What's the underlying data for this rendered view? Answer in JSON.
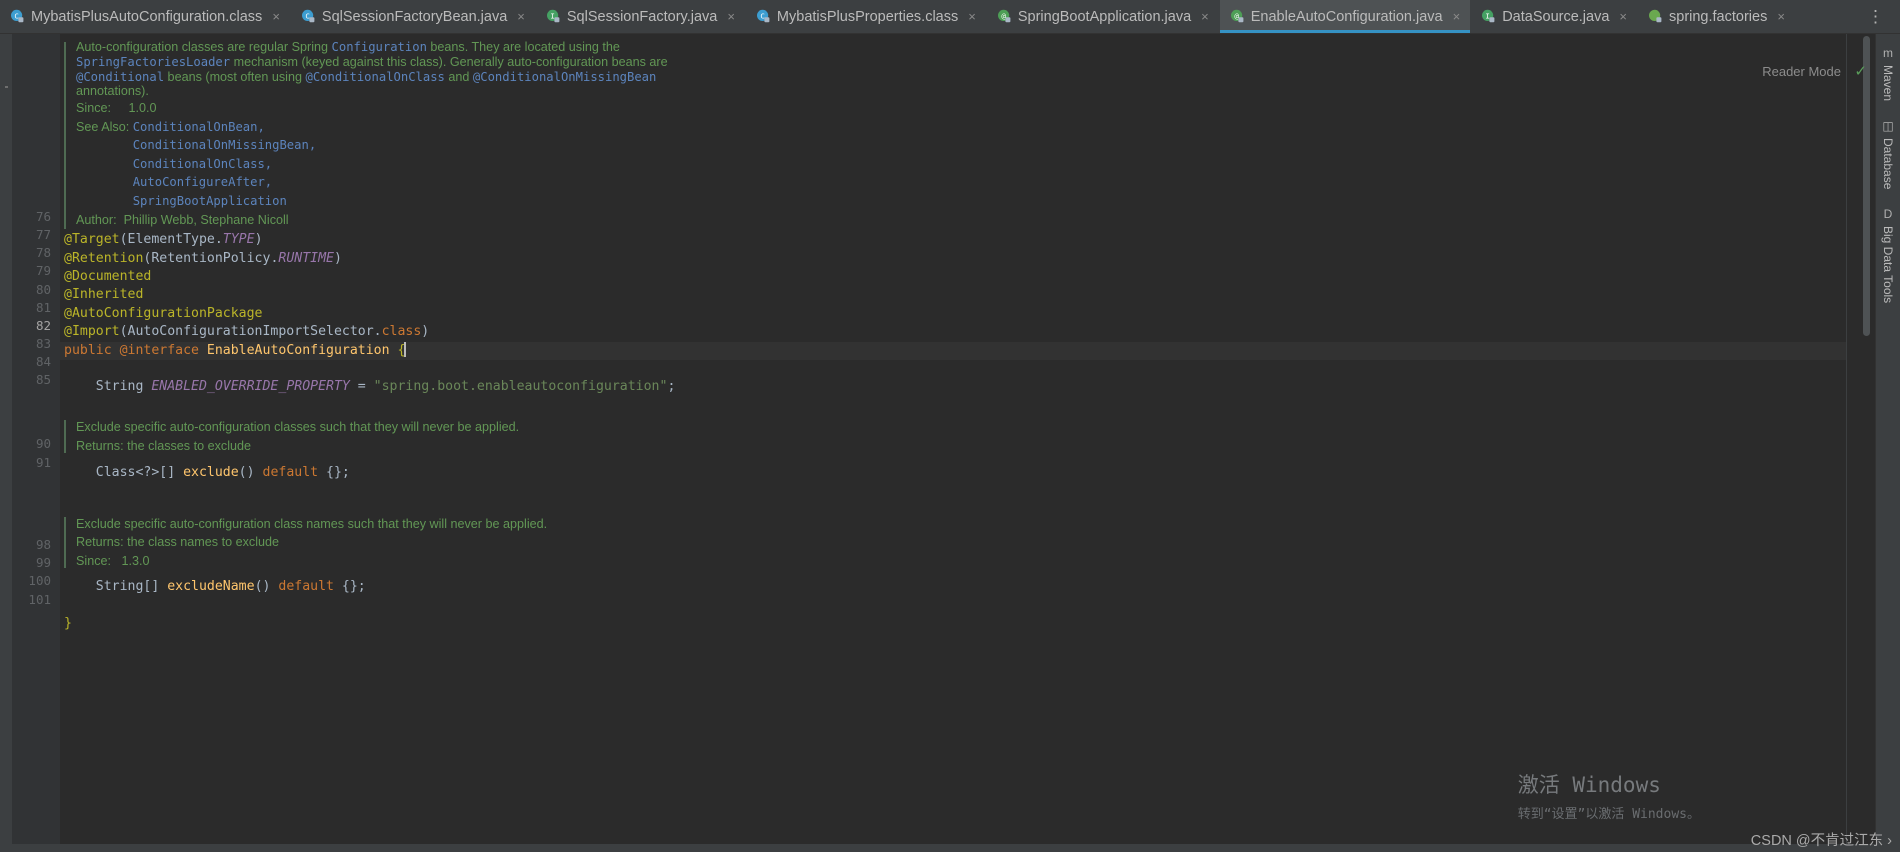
{
  "window": {
    "title": "EnableAutoConfiguration.java",
    "more_options_icon": "kebab-menu-icon"
  },
  "tabs": [
    {
      "label": "MybatisPlusAutoConfiguration.class",
      "icon": "java-class-file-icon",
      "icon_kind": "class",
      "active": false,
      "close": "×"
    },
    {
      "label": "SqlSessionFactoryBean.java",
      "icon": "java-class-file-icon",
      "icon_kind": "class",
      "active": false,
      "close": "×"
    },
    {
      "label": "SqlSessionFactory.java",
      "icon": "java-interface-file-icon",
      "icon_kind": "interface",
      "active": false,
      "close": "×"
    },
    {
      "label": "MybatisPlusProperties.class",
      "icon": "java-class-file-icon",
      "icon_kind": "class",
      "active": false,
      "close": "×"
    },
    {
      "label": "SpringBootApplication.java",
      "icon": "java-annotation-file-icon",
      "icon_kind": "annotation",
      "active": false,
      "close": "×"
    },
    {
      "label": "EnableAutoConfiguration.java",
      "icon": "java-annotation-file-icon",
      "icon_kind": "annotation",
      "active": true,
      "close": "×"
    },
    {
      "label": "DataSource.java",
      "icon": "java-interface-file-icon",
      "icon_kind": "interface",
      "active": false,
      "close": "×"
    },
    {
      "label": "spring.factories",
      "icon": "spring-factories-file-icon",
      "icon_kind": "spring",
      "active": false,
      "close": "×"
    }
  ],
  "editor": {
    "reader_mode_label": "Reader Mode",
    "inspection_status_icon": "green-check-icon",
    "javadoc_class": {
      "paragraph": [
        {
          "segments": [
            {
              "t": "Auto-configuration classes are regular Spring ",
              "k": "text"
            },
            {
              "t": "Configuration",
              "k": "code"
            },
            {
              "t": " beans. They are located using the",
              "k": "text"
            }
          ]
        },
        {
          "segments": [
            {
              "t": "SpringFactoriesLoader",
              "k": "code"
            },
            {
              "t": " mechanism (keyed against this class). Generally auto-configuration beans are",
              "k": "text"
            }
          ]
        },
        {
          "segments": [
            {
              "t": "@Conditional",
              "k": "code"
            },
            {
              "t": " beans (most often using ",
              "k": "text"
            },
            {
              "t": "@ConditionalOnClass",
              "k": "code"
            },
            {
              "t": " and ",
              "k": "text"
            },
            {
              "t": "@ConditionalOnMissingBean",
              "k": "code"
            }
          ]
        },
        {
          "segments": [
            {
              "t": "annotations).",
              "k": "text"
            }
          ]
        }
      ],
      "since_label": "Since:",
      "since_value": "1.0.0",
      "see_also_label": "See Also:",
      "see_also": [
        "ConditionalOnBean,",
        "ConditionalOnMissingBean,",
        "ConditionalOnClass,",
        "AutoConfigureAfter,",
        "SpringBootApplication"
      ],
      "author_label": "Author:",
      "author_value": "Phillip Webb, Stephane Nicoll"
    },
    "line_numbers": [
      "76",
      "77",
      "78",
      "79",
      "80",
      "81",
      "82",
      "83",
      "84",
      "85",
      "90",
      "91",
      "98",
      "99",
      "100",
      "101"
    ],
    "code_lines": [
      {
        "num": "76",
        "fold": true,
        "tokens": [
          {
            "t": "@Target",
            "k": "anno"
          },
          {
            "t": "(ElementType.",
            "k": "plain"
          },
          {
            "t": "TYPE",
            "k": "field"
          },
          {
            "t": ")",
            "k": "plain"
          }
        ]
      },
      {
        "num": "77",
        "tokens": [
          {
            "t": "@Retention",
            "k": "anno"
          },
          {
            "t": "(RetentionPolicy.",
            "k": "plain"
          },
          {
            "t": "RUNTIME",
            "k": "field"
          },
          {
            "t": ")",
            "k": "plain"
          }
        ]
      },
      {
        "num": "78",
        "tokens": [
          {
            "t": "@Documented",
            "k": "anno"
          }
        ]
      },
      {
        "num": "79",
        "tokens": [
          {
            "t": "@Inherited",
            "k": "anno"
          }
        ]
      },
      {
        "num": "80",
        "tokens": [
          {
            "t": "@AutoConfigurationPackage",
            "k": "anno"
          }
        ]
      },
      {
        "num": "81",
        "bulb": true,
        "tokens": [
          {
            "t": "@Import",
            "k": "anno"
          },
          {
            "t": "(AutoConfigurationImportSelector.",
            "k": "plain"
          },
          {
            "t": "class",
            "k": "kw"
          },
          {
            "t": ")",
            "k": "plain"
          }
        ]
      },
      {
        "num": "82",
        "current": true,
        "tokens": [
          {
            "t": "public ",
            "k": "kw"
          },
          {
            "t": "@interface ",
            "k": "kw"
          },
          {
            "t": "EnableAutoConfiguration ",
            "k": "typename"
          },
          {
            "t": "{",
            "k": "anno"
          }
        ]
      },
      {
        "num": "83",
        "tokens": []
      },
      {
        "num": "84",
        "tokens": [
          {
            "t": "    String ",
            "k": "plain"
          },
          {
            "t": "ENABLED_OVERRIDE_PROPERTY",
            "k": "field"
          },
          {
            "t": " = ",
            "k": "plain"
          },
          {
            "t": "\"spring.boot.enableautoconfiguration\"",
            "k": "str"
          },
          {
            "t": ";",
            "k": "plain"
          }
        ]
      },
      {
        "num": "85",
        "tokens": []
      }
    ],
    "javadoc_exclude": {
      "description": "Exclude specific auto-configuration classes such that they will never be applied.",
      "returns": "Returns: the classes to exclude"
    },
    "exclude_method": {
      "num": "90",
      "tokens": [
        {
          "t": "    Class<?>[] ",
          "k": "plain"
        },
        {
          "t": "exclude",
          "k": "typename"
        },
        {
          "t": "() ",
          "k": "plain"
        },
        {
          "t": "default ",
          "k": "kw"
        },
        {
          "t": "{};",
          "k": "plain"
        }
      ]
    },
    "javadoc_exclude_name": {
      "description": "Exclude specific auto-configuration class names such that they will never be applied.",
      "returns": "Returns: the class names to exclude",
      "since_label": "Since:",
      "since_value": "1.3.0"
    },
    "exclude_name_method": {
      "num": "98",
      "tokens": [
        {
          "t": "    String[] ",
          "k": "plain"
        },
        {
          "t": "excludeName",
          "k": "typename"
        },
        {
          "t": "() ",
          "k": "plain"
        },
        {
          "t": "default ",
          "k": "kw"
        },
        {
          "t": "{};",
          "k": "plain"
        }
      ]
    },
    "closing_brace": {
      "num": "100",
      "tokens": [
        {
          "t": "}",
          "k": "anno"
        }
      ]
    },
    "last_line": "101"
  },
  "right_toolbar": [
    {
      "label": "Maven",
      "icon": "maven-icon",
      "glyph": "m"
    },
    {
      "label": "Database",
      "icon": "database-icon",
      "glyph": "▥"
    },
    {
      "label": "Big Data Tools",
      "icon": "big-data-tools-icon",
      "glyph": "D"
    }
  ],
  "watermark": {
    "line1": "激活 Windows",
    "line2": "转到“设置”以激活 Windows。"
  },
  "attribution": "CSDN @不肯过江东 ›",
  "colors": {
    "background": "#2b2b2b",
    "chrome": "#3c3f41",
    "active_tab": "#4e5254",
    "accent": "#3592c4",
    "gutter": "#313335",
    "annotation": "#bbb529",
    "keyword": "#cc7832",
    "string": "#6a8759",
    "field": "#9876aa",
    "method": "#ffc66d",
    "javadoc": "#629755",
    "javadoc_link": "#5c84bd"
  }
}
